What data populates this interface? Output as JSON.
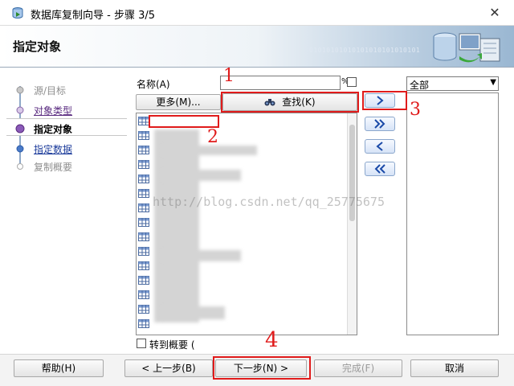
{
  "window": {
    "title": "数据库复制向导 - 步骤 3/5"
  },
  "banner": {
    "heading": "指定对象",
    "binary_text": "01010101010101010101010101"
  },
  "steps": [
    {
      "label": "源/目标",
      "state": "done"
    },
    {
      "label": "对象类型",
      "state": "visited"
    },
    {
      "label": "指定对象",
      "state": "current"
    },
    {
      "label": "指定数据",
      "state": "next"
    },
    {
      "label": "复制概要",
      "state": "future"
    }
  ],
  "search": {
    "name_label": "名称(A)",
    "name_value": "",
    "percent_symbol": "%",
    "more_button": "更多(M)...",
    "find_button": "查找(K)"
  },
  "available_list": {
    "row_count": 15
  },
  "filter": {
    "selected": "全部"
  },
  "goto_summary_label": "转到概要 (",
  "watermark": "http://blog.csdn.net/qq_25775675",
  "footer": {
    "help": "帮助(H)",
    "back": "< 上一步(B)",
    "next": "下一步(N) >",
    "finish": "完成(F)",
    "cancel": "取消"
  },
  "annotations": [
    "1",
    "2",
    "3",
    "4"
  ]
}
